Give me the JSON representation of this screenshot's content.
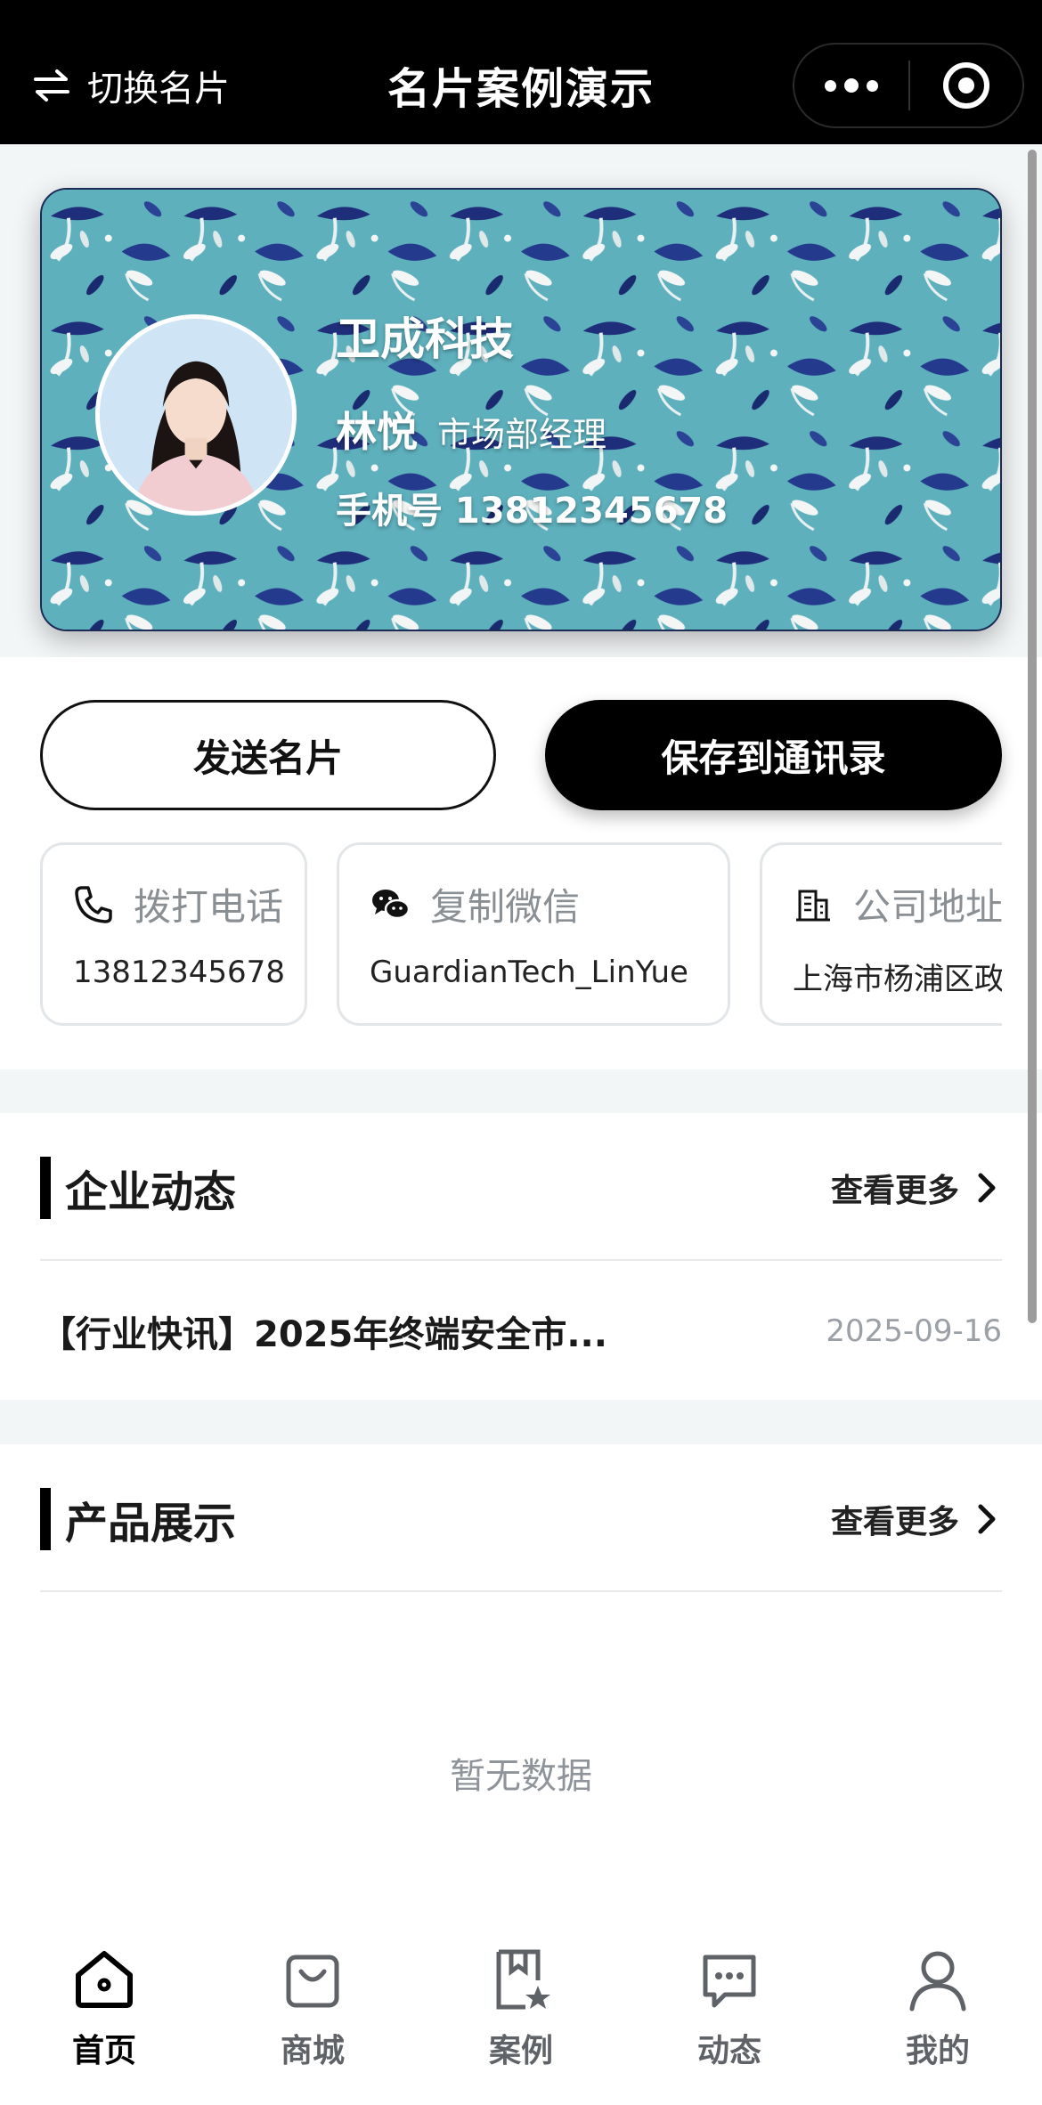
{
  "header": {
    "switch_label": "切换名片",
    "title": "名片案例演示"
  },
  "card": {
    "company": "卫成科技",
    "name": "林悦",
    "role": "市场部经理",
    "phone_line": "手机号 13812345678"
  },
  "actions": {
    "send_label": "发送名片",
    "save_label": "保存到通讯录"
  },
  "contacts": [
    {
      "label": "拨打电话",
      "value": "13812345678",
      "icon": "phone-icon"
    },
    {
      "label": "复制微信",
      "value": "GuardianTech_LinYue",
      "icon": "wechat-icon"
    },
    {
      "label": "公司地址",
      "value": "上海市杨浦区政",
      "icon": "building-icon"
    }
  ],
  "news": {
    "title": "企业动态",
    "more_label": "查看更多",
    "items": [
      {
        "text": "【行业快讯】2025年终端安全市...",
        "date": "2025-09-16"
      }
    ]
  },
  "products": {
    "title": "产品展示",
    "more_label": "查看更多",
    "empty_text": "暂无数据"
  },
  "tabbar": {
    "items": [
      {
        "label": "首页",
        "icon": "home-icon",
        "active": true
      },
      {
        "label": "商城",
        "icon": "shopping-bag-icon",
        "active": false
      },
      {
        "label": "案例",
        "icon": "bookmark-star-icon",
        "active": false
      },
      {
        "label": "动态",
        "icon": "chat-bubble-icon",
        "active": false
      },
      {
        "label": "我的",
        "icon": "user-icon",
        "active": false
      }
    ]
  },
  "colors": {
    "header_bg": "#000000",
    "card_bg": "#5eb0bd",
    "accent": "#000000"
  }
}
